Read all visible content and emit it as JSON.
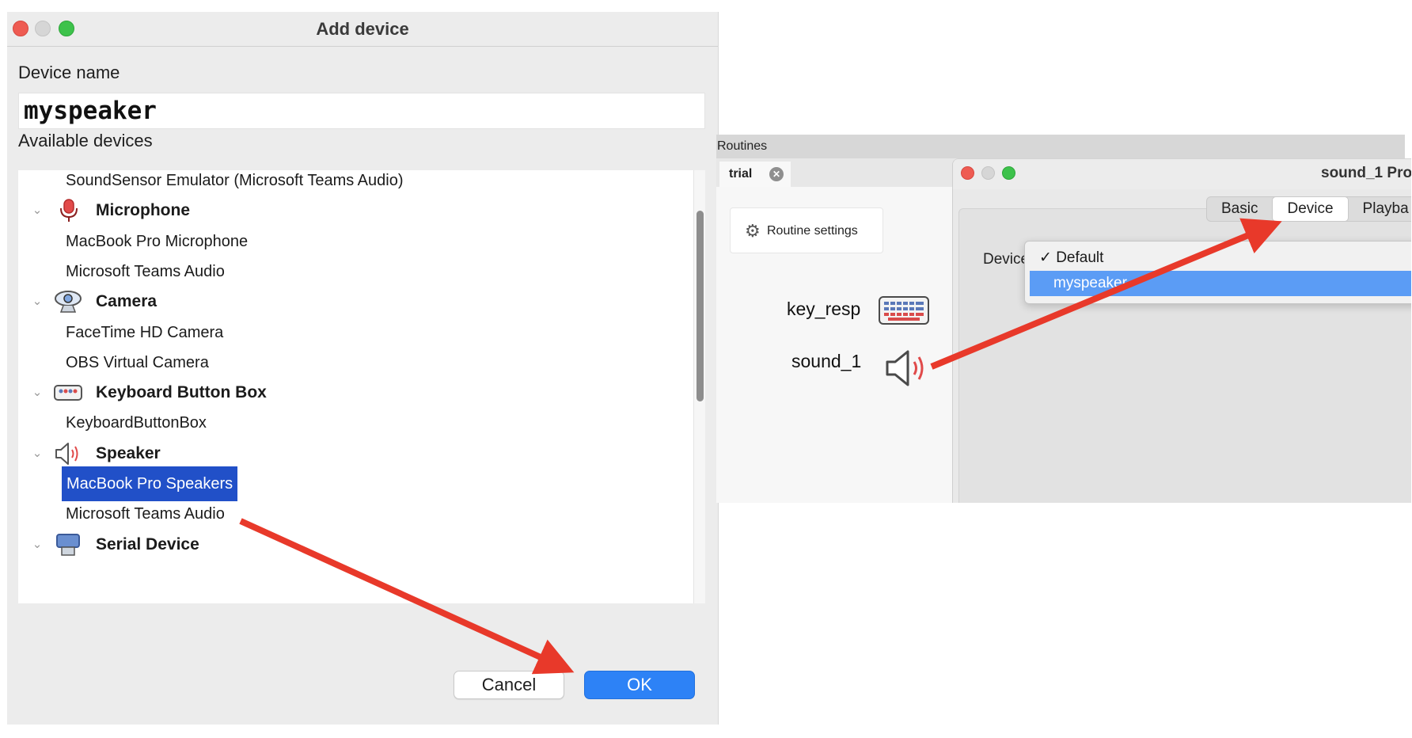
{
  "add_dialog": {
    "title": "Add device",
    "device_name_label": "Device name",
    "device_name_value": "myspeaker",
    "available_label": "Available devices",
    "list": [
      {
        "kind": "item",
        "label": "SoundSensor Emulator (Microsoft Teams Audio)"
      },
      {
        "kind": "group",
        "label": "Microphone",
        "icon": "microphone-icon"
      },
      {
        "kind": "item",
        "label": "MacBook Pro Microphone"
      },
      {
        "kind": "item",
        "label": "Microsoft Teams Audio"
      },
      {
        "kind": "group",
        "label": "Camera",
        "icon": "webcam-icon"
      },
      {
        "kind": "item",
        "label": "FaceTime HD Camera"
      },
      {
        "kind": "item",
        "label": "OBS Virtual Camera"
      },
      {
        "kind": "group",
        "label": "Keyboard Button Box",
        "icon": "button-box-icon"
      },
      {
        "kind": "item",
        "label": "KeyboardButtonBox"
      },
      {
        "kind": "group",
        "label": "Speaker",
        "icon": "speaker-icon"
      },
      {
        "kind": "item",
        "label": "MacBook Pro Speakers",
        "selected": true
      },
      {
        "kind": "item",
        "label": "Microsoft Teams Audio"
      },
      {
        "kind": "group",
        "label": "Serial Device",
        "icon": "serial-device-icon"
      }
    ],
    "cancel_label": "Cancel",
    "ok_label": "OK"
  },
  "routines": {
    "header": "Routines",
    "tab_label": "trial",
    "settings_button": "Routine settings",
    "components": [
      {
        "label": "key_resp",
        "icon": "keyboard-icon"
      },
      {
        "label": "sound_1",
        "icon": "speaker-icon"
      }
    ]
  },
  "properties": {
    "title": "sound_1 Pro",
    "tabs": [
      "Basic",
      "Device",
      "Playba"
    ],
    "active_tab": "Device",
    "device_label": "Device",
    "dropdown": {
      "options": [
        "Default",
        "myspeaker"
      ],
      "checked": "Default",
      "checkmark": "✓",
      "highlighted": "myspeaker"
    }
  },
  "colors": {
    "selection": "#2150c8",
    "ok_button": "#2d82f6",
    "dropdown_highlight": "#5b9cf5",
    "annotation_arrow": "#e8392a"
  }
}
